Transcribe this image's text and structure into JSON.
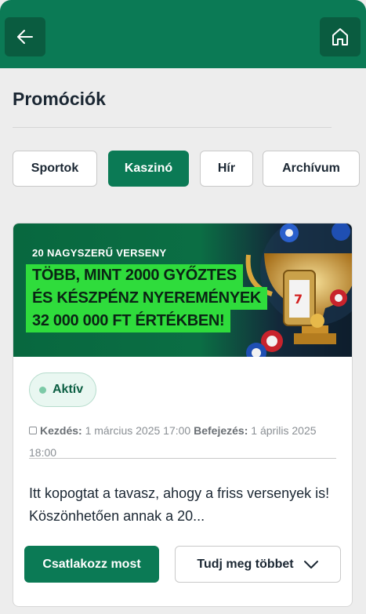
{
  "header": {
    "back_icon": "arrow-left-icon",
    "home_icon": "home-icon"
  },
  "page": {
    "title": "Promóciók"
  },
  "filters": [
    {
      "label": "Sportok",
      "active": false
    },
    {
      "label": "Kaszinó",
      "active": true
    },
    {
      "label": "Hír",
      "active": false
    },
    {
      "label": "Archívum",
      "active": false
    }
  ],
  "promo": {
    "banner": {
      "kicker": "20 NAGYSZERŰ VERSENY",
      "line1": "TÖBB, MINT 2000 GYŐZTES",
      "line2": "ÉS KÉSZPÉNZ NYEREMÉNYEK",
      "line3": "32 000 000 FT ÉRTÉKBEN!"
    },
    "status": "Aktív",
    "start_label": "Kezdés:",
    "start_value": "1 március 2025 17:00",
    "end_label": "Befejezés:",
    "end_value": "1 április 2025 18:00",
    "description": "Itt kopogtat a tavasz, ahogy a friss versenyek is! Köszönhetően annak a 20...",
    "join_label": "Csatlakozz most",
    "more_label": "Tudj meg többet"
  },
  "colors": {
    "brand_green": "#0b7a55",
    "banner_highlight": "#2fdc3c"
  }
}
